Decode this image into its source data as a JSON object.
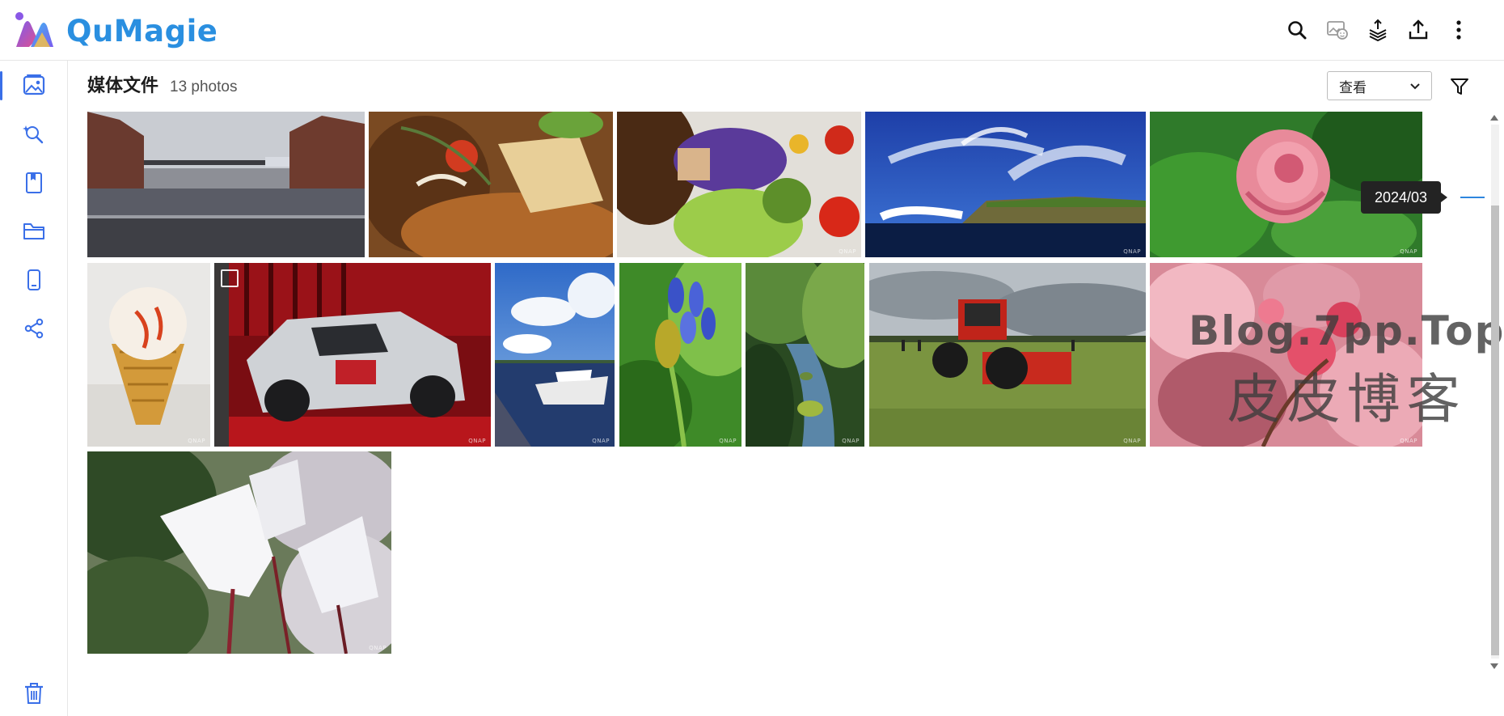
{
  "app": {
    "name": "QuMagie"
  },
  "topbar": {
    "actions": [
      {
        "name": "search-button",
        "icon": "search-icon"
      },
      {
        "name": "face-recognition-button",
        "icon": "face-photo-icon"
      },
      {
        "name": "background-tasks-button",
        "icon": "tasks-stack-icon"
      },
      {
        "name": "upload-button",
        "icon": "upload-icon"
      },
      {
        "name": "more-menu-button",
        "icon": "more-vertical-icon"
      }
    ]
  },
  "sidebar": {
    "items": [
      {
        "key": "photos",
        "icon": "photos-icon",
        "active": true
      },
      {
        "key": "smart-albums",
        "icon": "magic-search-icon"
      },
      {
        "key": "albums",
        "icon": "album-icon"
      },
      {
        "key": "folders",
        "icon": "folder-icon"
      },
      {
        "key": "device",
        "icon": "mobile-device-icon"
      },
      {
        "key": "shared",
        "icon": "share-icon"
      },
      {
        "key": "trash",
        "icon": "trash-icon"
      }
    ]
  },
  "main": {
    "title": "媒体文件",
    "count_text": "13 photos",
    "view_select": {
      "value": "查看"
    },
    "filter_icon": "filter-icon"
  },
  "photos": [
    {
      "subject": "brick-warehouse-canal",
      "watermark": ""
    },
    {
      "subject": "food-curry-plate",
      "watermark": ""
    },
    {
      "subject": "food-vegetables",
      "watermark": "QNAP"
    },
    {
      "subject": "sea-cliff-blue-sky",
      "watermark": "QNAP"
    },
    {
      "subject": "pink-flower",
      "watermark": "QNAP"
    },
    {
      "subject": "ice-cream-cone",
      "watermark": "QNAP"
    },
    {
      "subject": "race-car",
      "watermark": "QNAP"
    },
    {
      "subject": "yacht-harbor",
      "watermark": "QNAP"
    },
    {
      "subject": "blue-agapanthus",
      "watermark": "QNAP"
    },
    {
      "subject": "forest-stream",
      "watermark": "QNAP"
    },
    {
      "subject": "red-tractor",
      "watermark": "QNAP"
    },
    {
      "subject": "pink-blossoms",
      "watermark": "QNAP"
    },
    {
      "subject": "white-cyclamen",
      "watermark": "QNAP"
    }
  ],
  "timeline": {
    "current_label": "2024/03",
    "scroll_position": 0.15
  },
  "overlay_watermark": {
    "line1": "Blog.7pp.Top",
    "line2": "皮皮博客"
  },
  "colors": {
    "accent": "#3a6fe8",
    "logo_blue": "#2a8fe0",
    "timeline_marker": "#2e86de",
    "tooltip_bg": "#232323"
  }
}
